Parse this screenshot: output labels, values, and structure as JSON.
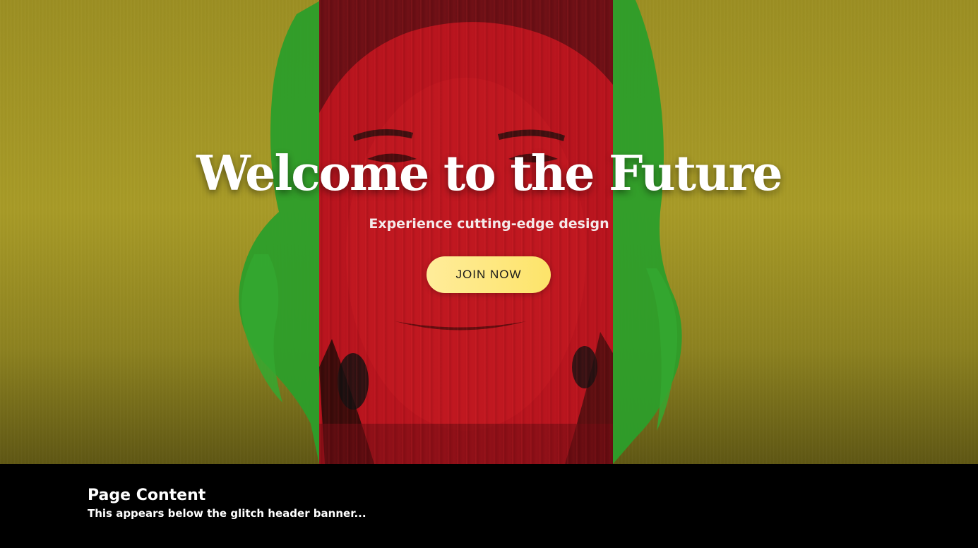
{
  "hero": {
    "title": "Welcome to the Future",
    "subtitle": "Experience cutting-edge design",
    "button_label": "JOIN NOW"
  },
  "content": {
    "heading": "Page Content",
    "text": "This appears below the glitch header banner..."
  },
  "colors": {
    "hero_background": "#a89b27",
    "glitch_red": "#b8141e",
    "hair_green": "#2ea12a",
    "button_gradient_start": "#ffec9a",
    "button_gradient_end": "#fde46a",
    "content_background": "#000000"
  }
}
